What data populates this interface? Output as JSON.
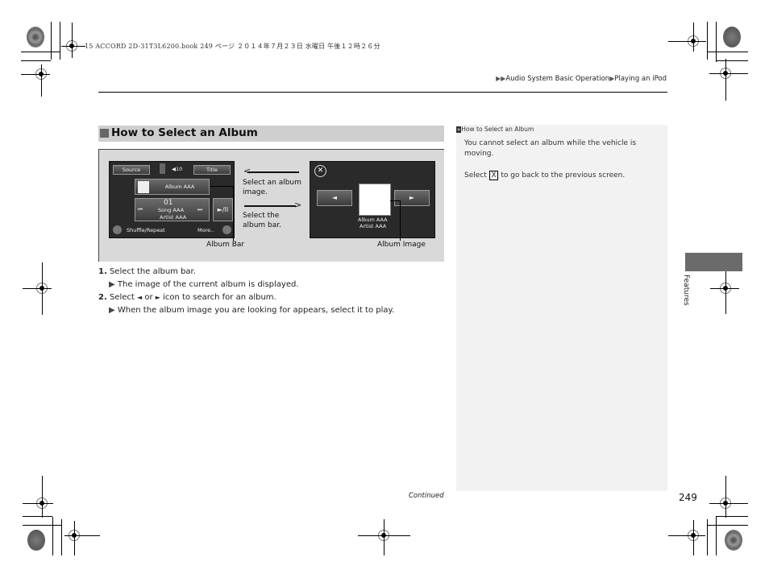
{
  "file_header": "15 ACCORD 2D-31T3L6200.book  249 ページ  ２０１４年７月２３日  水曜日  午後１２時２６分",
  "breadcrumb": {
    "prefix_icon": "double-triangle-right-icon",
    "items": [
      "Audio System Basic Operation",
      "Playing an iPod"
    ],
    "separator_icon": "triangle-right-icon"
  },
  "section": {
    "title": "How to Select an Album"
  },
  "figure": {
    "left_screen": {
      "source_button": "Source",
      "volume": "10",
      "title_button": "Title",
      "album_bar": "Album AAA",
      "track_number": "01",
      "song": "Song AAA",
      "artist": "Artist AAA",
      "play_pause": "►/II",
      "shuffle_repeat": "Shuffle/Repeat",
      "more": "More.."
    },
    "arrow_labels": {
      "to_left": "Select an album image.",
      "to_right": "Select the album bar."
    },
    "right_screen": {
      "close_icon": "x-circle-icon",
      "prev_icon": "◄",
      "next_icon": "►",
      "album": "Album AAA",
      "artist": "Artist AAA"
    },
    "callouts": {
      "album_bar": "Album Bar",
      "album_image": "Album Image"
    }
  },
  "steps": [
    {
      "num": "1.",
      "text": "Select the album bar.",
      "result": "The image of the current album is displayed."
    },
    {
      "num": "2.",
      "text_before": "Select",
      "icon_left": "◄",
      "text_or": "or",
      "icon_right": "►",
      "text_after": "icon to search for an album.",
      "result": "When the album image you are looking for appears, select it to play."
    }
  ],
  "sidebar": {
    "heading": "How to Select an Album",
    "paragraph1": "You cannot select an album while the vehicle is moving.",
    "paragraph2_before": "Select",
    "paragraph2_key": "X",
    "paragraph2_after": "to go back to the previous screen."
  },
  "tab_label": "Features",
  "continued": "Continued",
  "page_number": "249"
}
